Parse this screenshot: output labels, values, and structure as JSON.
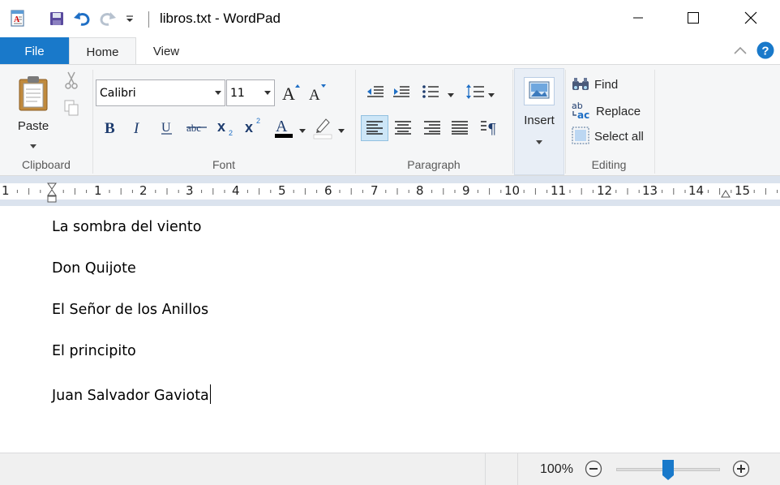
{
  "window": {
    "title": "libros.txt - WordPad",
    "minimize_icon": "minimize-icon",
    "maximize_icon": "maximize-icon",
    "close_icon": "close-icon"
  },
  "quick_access": {
    "app_icon": "wordpad-app-icon",
    "save_icon": "save-icon",
    "undo_icon": "undo-icon",
    "redo_icon": "redo-icon",
    "customize_icon": "customize-dropdown-icon"
  },
  "tabs": {
    "file": "File",
    "home": "Home",
    "view": "View"
  },
  "ribbon": {
    "collapse_icon": "chevron-up-icon",
    "help_icon": "help-icon",
    "clipboard": {
      "label": "Clipboard",
      "paste": "Paste"
    },
    "font": {
      "label": "Font",
      "family": "Calibri",
      "size": "11"
    },
    "paragraph": {
      "label": "Paragraph"
    },
    "insert": {
      "label": "Insert"
    },
    "editing": {
      "label": "Editing",
      "find": "Find",
      "replace": "Replace",
      "select_all": "Select all"
    }
  },
  "ruler": {
    "numbers": [
      "1",
      "1",
      "2",
      "3",
      "4",
      "5",
      "6",
      "7",
      "8",
      "9",
      "10",
      "11",
      "12",
      "13",
      "14",
      "15"
    ]
  },
  "document": {
    "lines": [
      "La sombra del viento",
      "Don Quijote",
      "El Señor de los Anillos",
      "El principito",
      "Juan Salvador Gaviota"
    ]
  },
  "status": {
    "zoom": "100%",
    "zoom_level_percent": 100
  },
  "colors": {
    "file_tab": "#1979ca",
    "ribbon_bg": "#f5f6f7",
    "selected_button": "#cde6f7",
    "zoom_thumb": "#1979ca",
    "help": "#1979ca"
  }
}
